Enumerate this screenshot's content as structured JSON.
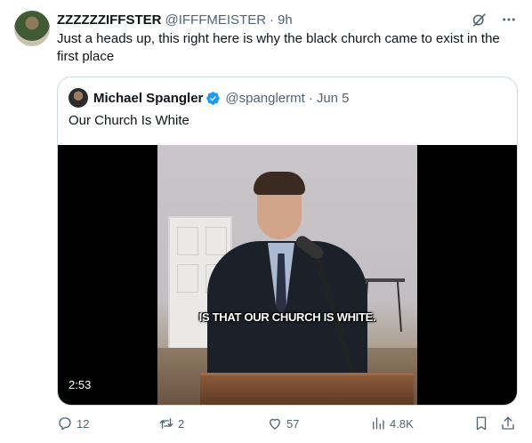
{
  "tweet": {
    "author_name": "ZZZZZZIFFSTER",
    "author_handle": "@IFFFMEISTER",
    "separator": "·",
    "time": "9h",
    "text": "Just a heads up, this right here is why the black church came to exist in the first place"
  },
  "quote": {
    "author_name": "Michael Spangler",
    "author_handle": "@spanglermt",
    "separator": "·",
    "time": "Jun 5",
    "text": "Our Church Is White",
    "video": {
      "caption": "IS THAT OUR CHURCH IS WHITE.",
      "duration": "2:53"
    }
  },
  "actions": {
    "replies": "12",
    "reposts": "2",
    "likes": "57",
    "views": "4.8K"
  },
  "colors": {
    "text_primary": "#0f1419",
    "text_secondary": "#536471",
    "verified_blue": "#1d9bf0",
    "border": "#cfd9de",
    "repost_green": "#00ba7c"
  },
  "icons": {
    "grok": "grok-icon",
    "more": "more-icon",
    "verified": "verified-badge-icon",
    "reply": "reply-icon",
    "repost": "repost-icon",
    "like": "like-icon",
    "views": "views-icon",
    "bookmark": "bookmark-icon",
    "share": "share-icon"
  }
}
